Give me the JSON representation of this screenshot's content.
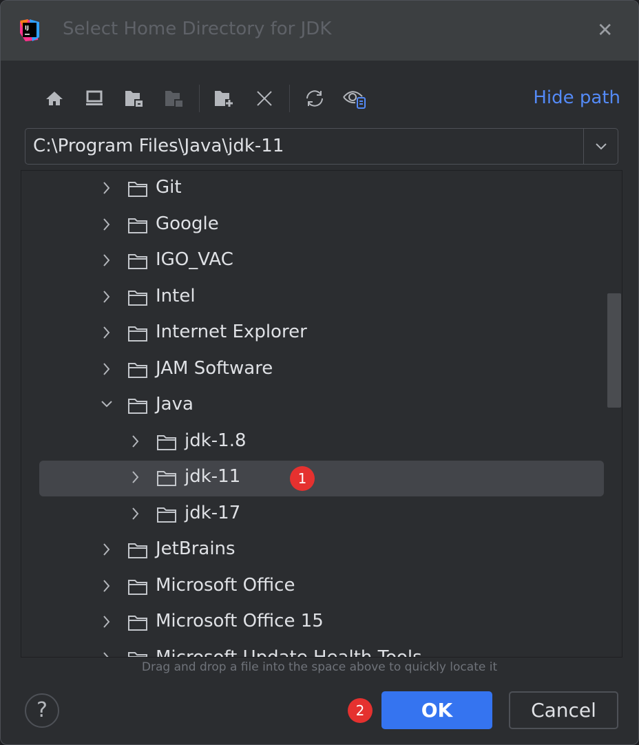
{
  "window": {
    "title": "Select Home Directory for JDK",
    "logo_text": "IJ"
  },
  "toolbar": {
    "icons": [
      "home-icon",
      "desktop-icon",
      "project-folder-icon",
      "module-folder-icon",
      "new-folder-icon",
      "delete-icon",
      "refresh-icon",
      "show-hidden-icon"
    ],
    "hide_path_label": "Hide path"
  },
  "path": {
    "value": "C:\\Program Files\\Java\\jdk-11"
  },
  "tree": {
    "items": [
      {
        "label": "Git",
        "level": 0,
        "expanded": false
      },
      {
        "label": "Google",
        "level": 0,
        "expanded": false
      },
      {
        "label": "IGO_VAC",
        "level": 0,
        "expanded": false
      },
      {
        "label": "Intel",
        "level": 0,
        "expanded": false
      },
      {
        "label": "Internet Explorer",
        "level": 0,
        "expanded": false
      },
      {
        "label": "JAM Software",
        "level": 0,
        "expanded": false
      },
      {
        "label": "Java",
        "level": 0,
        "expanded": true
      },
      {
        "label": "jdk-1.8",
        "level": 1,
        "expanded": false
      },
      {
        "label": "jdk-11",
        "level": 1,
        "expanded": false,
        "selected": true
      },
      {
        "label": "jdk-17",
        "level": 1,
        "expanded": false
      },
      {
        "label": "JetBrains",
        "level": 0,
        "expanded": false
      },
      {
        "label": "Microsoft Office",
        "level": 0,
        "expanded": false
      },
      {
        "label": "Microsoft Office 15",
        "level": 0,
        "expanded": false
      },
      {
        "label": "Microsoft Update Health Tools",
        "level": 0,
        "expanded": false
      }
    ]
  },
  "hint": "Drag and drop a file into the space above to quickly locate it",
  "annotations": {
    "step1": "1",
    "step2": "2"
  },
  "buttons": {
    "help": "?",
    "ok": "OK",
    "cancel": "Cancel"
  },
  "colors": {
    "accent": "#3574f0",
    "link": "#548af7",
    "badge": "#e5312f",
    "selection": "#43454a"
  }
}
